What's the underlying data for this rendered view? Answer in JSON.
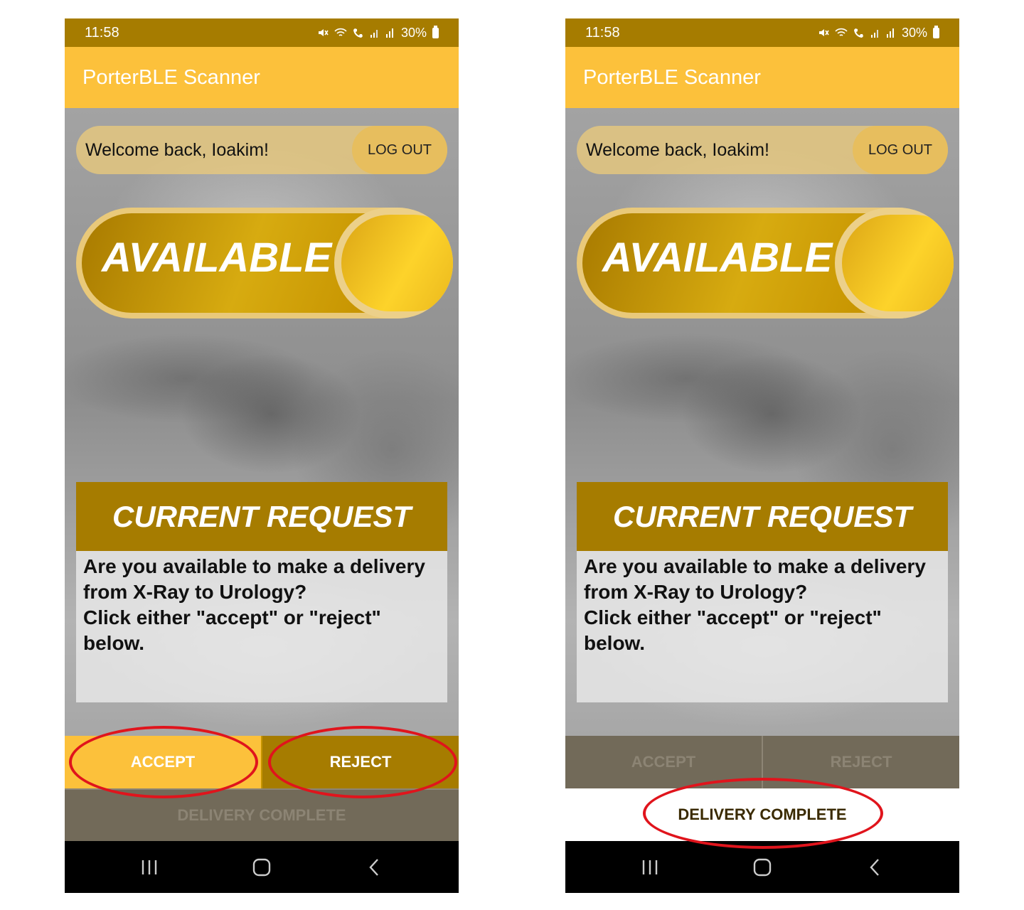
{
  "colors": {
    "status_bar": "#a67c00",
    "app_bar": "#fcc13b",
    "gold_dark": "#a67c00",
    "disabled": "#726a59",
    "callout": "#e0141c"
  },
  "screens": [
    {
      "status": {
        "time": "11:58",
        "battery": "30%",
        "icons": [
          "mute-icon",
          "wifi-icon",
          "wifi-call-icon",
          "signal-icon",
          "signal-r-icon",
          "battery-icon"
        ]
      },
      "app_title": "PorterBLE Scanner",
      "welcome": "Welcome back, Ioakim!",
      "logout_label": "LOG OUT",
      "availability_label": "AVAILABLE",
      "request": {
        "title": "CURRENT REQUEST",
        "lines": [
          "Are you available to make a delivery",
          "from X-Ray to Urology?",
          "Click either \"accept\" or \"reject\"",
          "below."
        ]
      },
      "accept_label": "ACCEPT",
      "reject_label": "REJECT",
      "complete_label": "DELIVERY COMPLETE",
      "state": "accept/reject enabled"
    },
    {
      "status": {
        "time": "11:58",
        "battery": "30%",
        "icons": [
          "mute-icon",
          "wifi-icon",
          "wifi-call-icon",
          "signal-icon",
          "signal-r-icon",
          "battery-icon"
        ]
      },
      "app_title": "PorterBLE Scanner",
      "welcome": "Welcome back, Ioakim!",
      "logout_label": "LOG OUT",
      "availability_label": "AVAILABLE",
      "request": {
        "title": "CURRENT REQUEST",
        "lines": [
          "Are you available to make a delivery",
          "from X-Ray to Urology?",
          "Click either \"accept\" or \"reject\"",
          "below."
        ]
      },
      "accept_label": "ACCEPT",
      "reject_label": "REJECT",
      "complete_label": "DELIVERY COMPLETE",
      "state": "delivery complete enabled"
    }
  ],
  "nav_icons": [
    "recent-apps-icon",
    "home-icon",
    "back-icon"
  ]
}
